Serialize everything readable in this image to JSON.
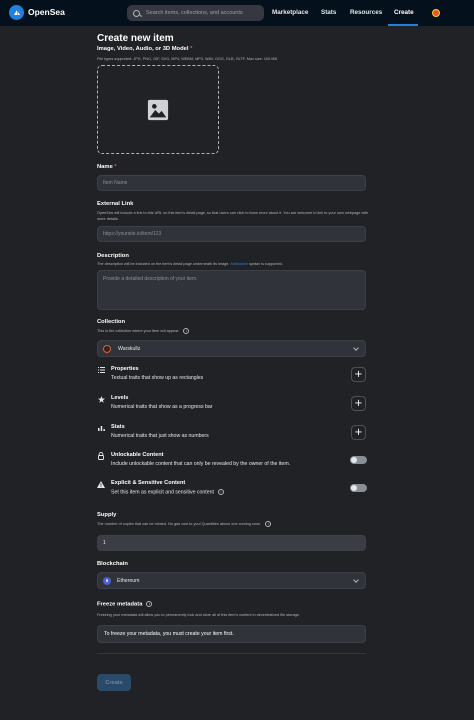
{
  "header": {
    "brand": "OpenSea",
    "search_placeholder": "Search items, collections, and accounts",
    "nav": [
      "Marketplace",
      "Stats",
      "Resources",
      "Create"
    ]
  },
  "form": {
    "title": "Create new item",
    "media": {
      "label": "Image, Video, Audio, or 3D Model",
      "required_mark": "*",
      "hint": "File types supported: JPG, PNG, GIF, SVG, MP4, WEBM, MP3, WAV, OGG, GLB, GLTF. Max size: 100 MB"
    },
    "name": {
      "label": "Name",
      "required_mark": "*",
      "placeholder": "Item Name"
    },
    "external_link": {
      "label": "External Link",
      "hint": "OpenSea will include a link to this URL on this item's detail page, so that users can click to learn more about it. You are welcome to link to your own webpage with more details.",
      "placeholder": "https://yoursite.io/item/123"
    },
    "description": {
      "label": "Description",
      "hint_before": "The description will be included on the item's detail page underneath its image.",
      "hint_link": "Markdown",
      "hint_after": "syntax is supported.",
      "placeholder": "Provide a detailed description of your item."
    },
    "collection": {
      "label": "Collection",
      "hint": "This is the collection where your item will appear.",
      "info_symbol": "i",
      "value": "Warskullz"
    },
    "properties": {
      "title": "Properties",
      "desc": "Textual traits that show up as rectangles",
      "button": "+"
    },
    "levels": {
      "title": "Levels",
      "desc": "Numerical traits that show as a progress bar",
      "button": "+"
    },
    "stats": {
      "title": "Stats",
      "desc": "Numerical traits that just show as numbers",
      "button": "+"
    },
    "unlockable": {
      "title": "Unlockable Content",
      "desc": "Include unlockable content that can only be revealed by the owner of the item.",
      "enabled": false
    },
    "explicit": {
      "title": "Explicit & Sensitive Content",
      "desc": "Set this item as explicit and sensitive content",
      "info_symbol": "i",
      "enabled": false
    },
    "supply": {
      "label": "Supply",
      "hint": "The number of copies that can be minted. No gas cost to you! Quantities above one coming soon.",
      "info_symbol": "i",
      "value": "1"
    },
    "blockchain": {
      "label": "Blockchain",
      "value": "Ethereum"
    },
    "freeze": {
      "label": "Freeze metadata",
      "info_symbol": "i",
      "hint": "Freezing your metadata will allow you to permanently lock and store all of this item's content in decentralized file storage.",
      "message": "To freeze your metadata, you must create your item first."
    },
    "submit": "Create"
  },
  "colors": {
    "header_bg": "#04111d",
    "page_bg": "#202225",
    "accent": "#2081e2",
    "field_bg": "#303339"
  }
}
